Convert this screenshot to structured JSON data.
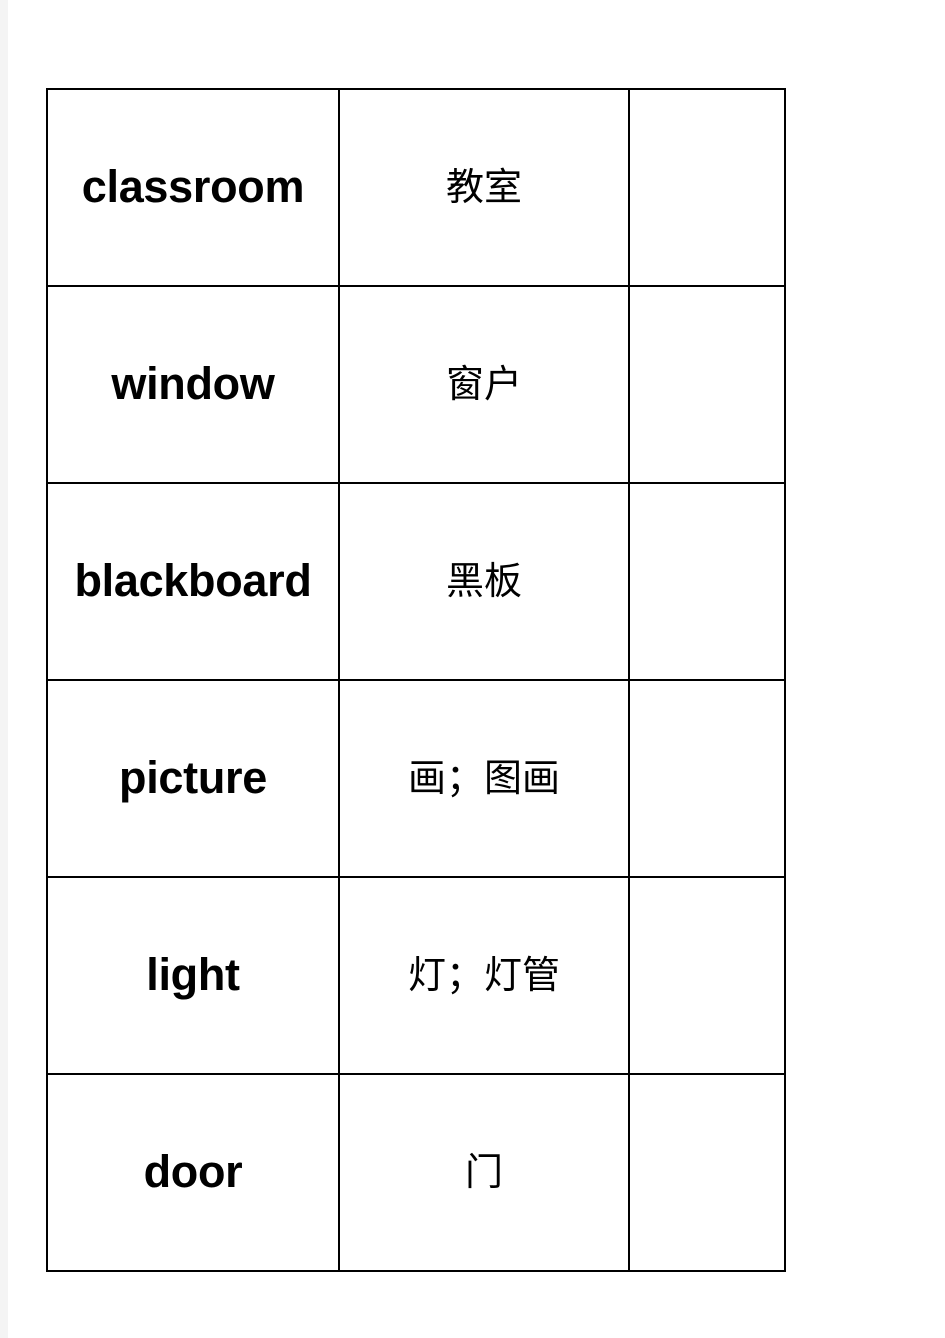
{
  "document": {
    "kind": "vocabulary-table",
    "page_background": "#f4f4f4",
    "sheet_background": "#ffffff",
    "border_color": "#000000",
    "text_color": "#000000"
  },
  "table": {
    "column_count": 3,
    "row_count": 6,
    "columns": [
      {
        "key": "english",
        "label": ""
      },
      {
        "key": "chinese",
        "label": ""
      },
      {
        "key": "blank",
        "label": ""
      }
    ],
    "rows": [
      {
        "english": "classroom",
        "chinese": "教室",
        "blank": ""
      },
      {
        "english": "window",
        "chinese": "窗户",
        "blank": ""
      },
      {
        "english": "blackboard",
        "chinese": "黑板",
        "blank": ""
      },
      {
        "english": "picture",
        "chinese": "画；图画",
        "blank": ""
      },
      {
        "english": "light",
        "chinese": "灯；灯管",
        "blank": ""
      },
      {
        "english": "door",
        "chinese": "门",
        "blank": ""
      }
    ]
  }
}
